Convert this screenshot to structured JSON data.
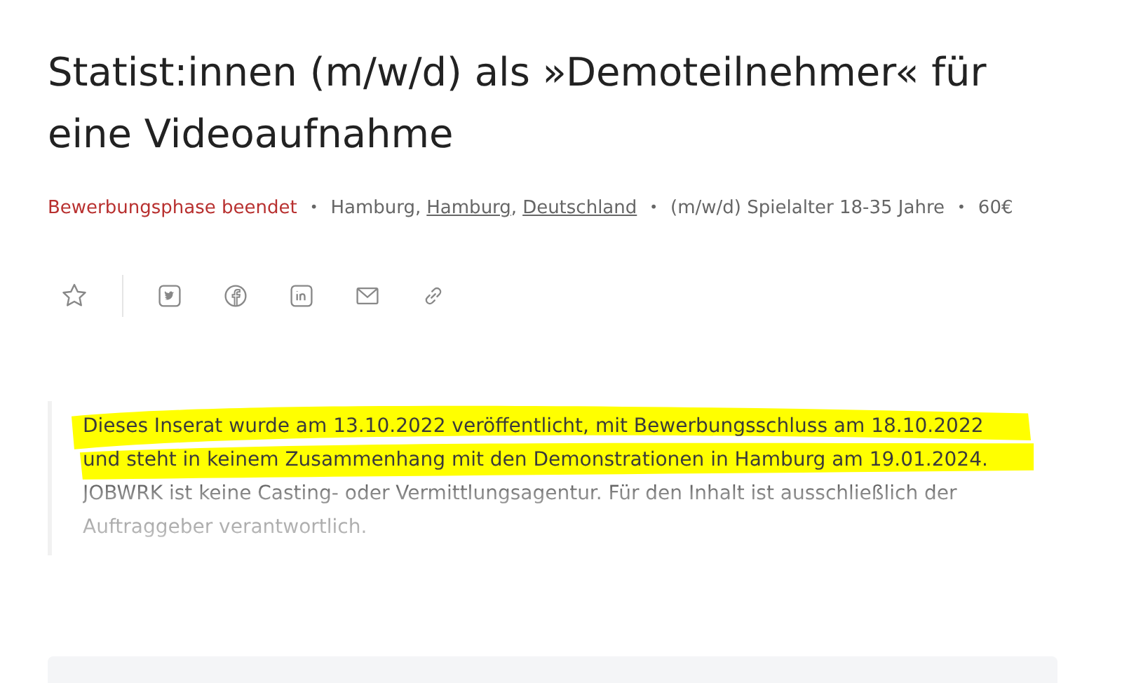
{
  "title": "Statist:innen (m/w/d) als »Demoteilnehmer« für eine Videoaufnahme",
  "meta": [
    {
      "kind": "status",
      "text": "Bewerbungsphase beendet"
    },
    {
      "kind": "location",
      "separator": "•",
      "parts": [
        {
          "text": "Hamburg",
          "link": false,
          "suffix": ","
        },
        {
          "text": "Hamburg",
          "link": true,
          "suffix": ","
        },
        {
          "text": "Deutschland",
          "link": true
        }
      ]
    },
    {
      "kind": "plain",
      "separator": "•",
      "text": "(m/w/d) Spielalter 18-35 Jahre"
    },
    {
      "kind": "plain",
      "separator": "•",
      "text": "60€"
    }
  ],
  "share_icons": [
    {
      "kind": "star"
    },
    {
      "kind": "twitter"
    },
    {
      "kind": "facebook"
    },
    {
      "kind": "linkedin"
    },
    {
      "kind": "mail"
    },
    {
      "kind": "link"
    }
  ],
  "notice": {
    "text": "Dieses Inserat wurde am 13.10.2022 veröffentlicht, mit Bewerbungsschluss am 18.10.2022 und steht in keinem Zusammenhang mit den Demonstrationen in Hamburg am 19.01.2024. JOBWRK ist keine Casting- oder Vermittlungsagentur. Für den Inhalt ist ausschließlich der Auftraggeber verantwortlich.",
    "highlighted": true
  }
}
